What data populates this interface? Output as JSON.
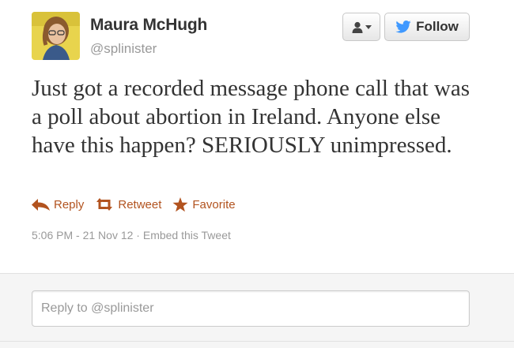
{
  "user": {
    "fullname": "Maura McHugh",
    "username": "@splinister"
  },
  "buttons": {
    "follow_label": "Follow",
    "user_dropdown_icon": "person-icon"
  },
  "tweet": {
    "text": "Just got a recorded message phone call that was a poll about abortion in Ireland. Anyone else have this happen? SERIOUSLY unimpressed."
  },
  "actions": {
    "reply_label": "Reply",
    "retweet_label": "Retweet",
    "favorite_label": "Favorite"
  },
  "meta": {
    "timestamp": "5:06 PM - 21 Nov 12",
    "separator": "·",
    "embed_label": "Embed this Tweet"
  },
  "reply": {
    "placeholder": "Reply to @splinister"
  },
  "colors": {
    "action": "#b2531f",
    "twitter_bird": "#4099ff",
    "avatar_bg": "#e8d44d"
  }
}
